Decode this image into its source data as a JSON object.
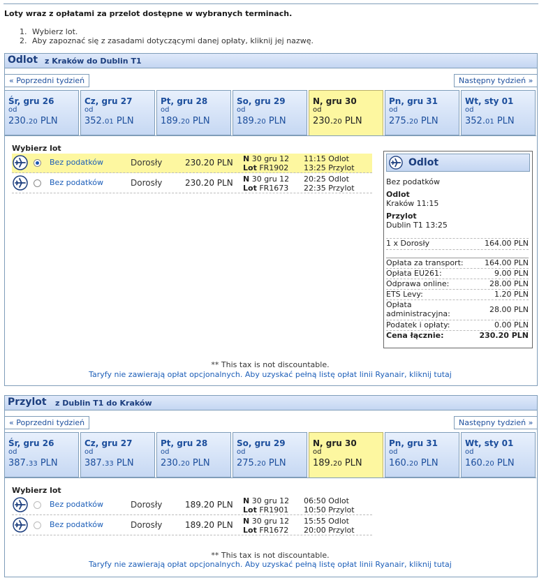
{
  "intro": {
    "title": "Loty wraz z opłatami za przelot dostępne w wybranych terminach.",
    "steps": [
      {
        "num": "1.",
        "text": "Wybierz lot."
      },
      {
        "num": "2.",
        "text": "Aby zapoznać się z zasadami dotyczącymi danej opłaty, kliknij jej nazwę."
      }
    ]
  },
  "outbound": {
    "title": "Odlot",
    "route": "z Kraków do Dublin T1",
    "prev_week": "« Poprzedni tydzień",
    "next_week": "Następny tydzień »",
    "from_label": "od",
    "dates": [
      {
        "day": "Śr, gru 26",
        "price_int": "230.",
        "price_dec": "20",
        "currency": " PLN"
      },
      {
        "day": "Cz, gru 27",
        "price_int": "352.",
        "price_dec": "01",
        "currency": " PLN"
      },
      {
        "day": "Pt, gru 28",
        "price_int": "189.",
        "price_dec": "20",
        "currency": " PLN"
      },
      {
        "day": "So, gru 29",
        "price_int": "189.",
        "price_dec": "20",
        "currency": " PLN"
      },
      {
        "day": "N, gru 30",
        "price_int": "230.",
        "price_dec": "20",
        "currency": " PLN"
      },
      {
        "day": "Pn, gru 31",
        "price_int": "275.",
        "price_dec": "20",
        "currency": " PLN"
      },
      {
        "day": "Wt, sty 01",
        "price_int": "352.",
        "price_dec": "01",
        "currency": " PLN"
      }
    ],
    "select_label": "Wybierz lot",
    "flights": [
      {
        "fare": "Bez podatków",
        "pax": "Dorosły",
        "price": "230.20 PLN",
        "day": "N",
        "date": "30 gru 12",
        "lot_label": "Lot",
        "flight_no": "FR1902",
        "dep": "11:15 Odlot",
        "arr": "13:25 Przylot"
      },
      {
        "fare": "Bez podatków",
        "pax": "Dorosły",
        "price": "230.20 PLN",
        "day": "N",
        "date": "30 gru 12",
        "lot_label": "Lot",
        "flight_no": "FR1673",
        "dep": "20:25 Odlot",
        "arr": "22:35 Przylot"
      }
    ],
    "note": "** This tax is not discountable.",
    "link": "Taryfy nie zawierają opłat opcjonalnych. Aby uzyskać pełną listę opłat linii Ryanair, kliknij tutaj"
  },
  "summary": {
    "title": "Odlot",
    "fare": "Bez podatków",
    "dep_label": "Odlot",
    "dep_value": "Kraków 11:15",
    "arr_label": "Przylot",
    "arr_value": "Dublin T1 13:25",
    "pax_line": {
      "label": "1 x Dorosły",
      "value": "164.00 PLN"
    },
    "fees": [
      {
        "label": "Opłata za transport:",
        "value": "164.00 PLN"
      },
      {
        "label": "Opłata EU261:",
        "value": "9.00 PLN"
      },
      {
        "label": "Odprawa online:",
        "value": "28.00 PLN"
      },
      {
        "label": "ETS Levy:",
        "value": "1.20 PLN"
      },
      {
        "label": "Opłata administracyjna:",
        "value": "28.00 PLN"
      },
      {
        "label": "Podatek i opłaty:",
        "value": "0.00 PLN"
      }
    ],
    "total_label": "Cena łącznie:",
    "total_value": "230.20 PLN"
  },
  "inbound": {
    "title": "Przylot",
    "route": "z Dublin T1 do Kraków",
    "prev_week": "« Poprzedni tydzień",
    "next_week": "Następny tydzień »",
    "from_label": "od",
    "dates": [
      {
        "day": "Śr, gru 26",
        "price_int": "387.",
        "price_dec": "33",
        "currency": " PLN"
      },
      {
        "day": "Cz, gru 27",
        "price_int": "387.",
        "price_dec": "33",
        "currency": " PLN"
      },
      {
        "day": "Pt, gru 28",
        "price_int": "230.",
        "price_dec": "20",
        "currency": " PLN"
      },
      {
        "day": "So, gru 29",
        "price_int": "275.",
        "price_dec": "20",
        "currency": " PLN"
      },
      {
        "day": "N, gru 30",
        "price_int": "189.",
        "price_dec": "20",
        "currency": " PLN"
      },
      {
        "day": "Pn, gru 31",
        "price_int": "160.",
        "price_dec": "20",
        "currency": " PLN"
      },
      {
        "day": "Wt, sty 01",
        "price_int": "160.",
        "price_dec": "20",
        "currency": " PLN"
      }
    ],
    "select_label": "Wybierz lot",
    "flights": [
      {
        "fare": "Bez podatków",
        "pax": "Dorosły",
        "price": "189.20 PLN",
        "day": "N",
        "date": "30 gru 12",
        "lot_label": "Lot",
        "flight_no": "FR1901",
        "dep": "06:50 Odlot",
        "arr": "10:50 Przylot"
      },
      {
        "fare": "Bez podatków",
        "pax": "Dorosły",
        "price": "189.20 PLN",
        "day": "N",
        "date": "30 gru 12",
        "lot_label": "Lot",
        "flight_no": "FR1672",
        "dep": "15:55 Odlot",
        "arr": "20:00 Przylot"
      }
    ],
    "note": "** This tax is not discountable.",
    "link": "Taryfy nie zawierają opłat opcjonalnych. Aby uzyskać pełną listę opłat linii Ryanair, kliknij tutaj"
  }
}
